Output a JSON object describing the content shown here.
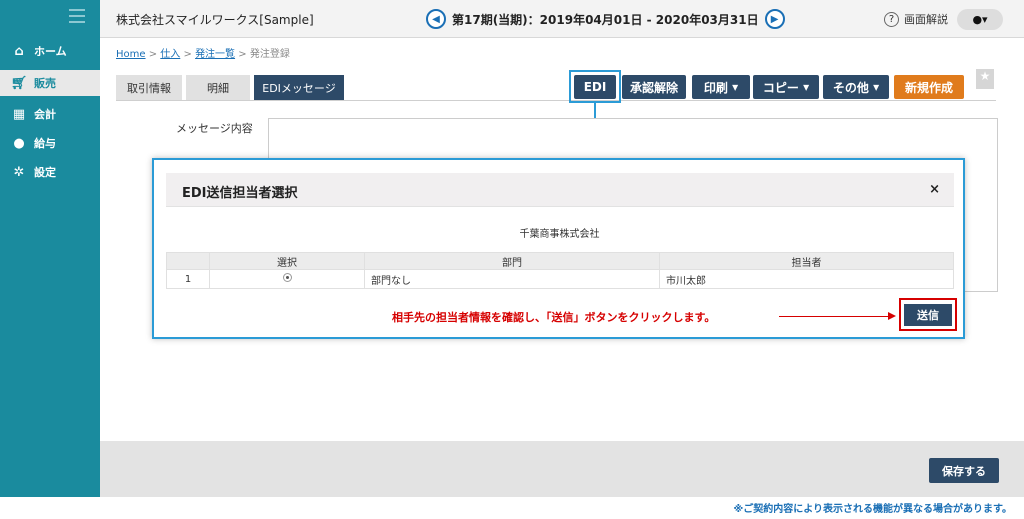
{
  "sidebar": {
    "items": [
      {
        "label": "ホーム",
        "icon": "home-icon"
      },
      {
        "label": "販売",
        "icon": "cart-icon"
      },
      {
        "label": "会計",
        "icon": "calculator-icon"
      },
      {
        "label": "給与",
        "icon": "money-bag-icon"
      },
      {
        "label": "設定",
        "icon": "gear-icon"
      }
    ]
  },
  "header": {
    "company": "株式会社スマイルワークス[Sample]",
    "period": "第17期(当期)：2019年04月01日 - 2020年03月31日",
    "help_label": "画面解説"
  },
  "breadcrumb": {
    "home": "Home",
    "sep": ">",
    "l1": "仕入",
    "l2": "発注一覧",
    "current": "発注登録"
  },
  "tabs": [
    "取引情報",
    "明細",
    "EDIメッセージ"
  ],
  "toolbar": {
    "edi": "EDI",
    "unapprove": "承認解除",
    "print": "印刷",
    "copy": "コピー",
    "other": "その他",
    "new": "新規作成"
  },
  "message": {
    "label": "メッセージ内容"
  },
  "modal": {
    "title": "EDI送信担当者選択",
    "close": "×",
    "partner": "千葉商事株式会社",
    "columns": [
      "",
      "選択",
      "部門",
      "担当者"
    ],
    "rows": [
      {
        "no": "1",
        "dept": "部門なし",
        "person": "市川太郎"
      }
    ],
    "note": "相手先の担当者情報を確認し、「送信」ボタンをクリックします。",
    "send": "送信"
  },
  "footer": {
    "save": "保存する"
  },
  "disclaimer": "※ご契約内容により表示される機能が異なる場合があります。",
  "colors": {
    "sidebar": "#1a8b9e",
    "primary": "#2d4a68",
    "accent": "#e07b1c",
    "highlight": "#2b9bd6",
    "alert": "#d60000"
  }
}
